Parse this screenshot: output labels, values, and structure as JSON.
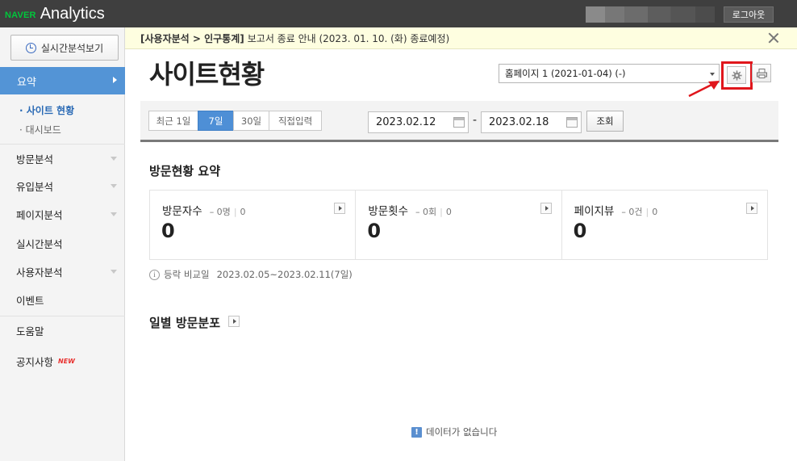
{
  "topbar": {
    "logo_brand": "NAVER",
    "logo_product": "Analytics",
    "logout_label": "로그아웃"
  },
  "sidebar": {
    "realtime_button": "실시간분석보기",
    "summary_label": "요약",
    "sub_items": [
      "· 사이트 현황",
      "· 대시보드"
    ],
    "menu": [
      "방문분석",
      "유입분석",
      "페이지분석",
      "실시간분석",
      "사용자분석",
      "이벤트",
      "도움말",
      "공지사항"
    ],
    "new_badge": "NEW"
  },
  "notice": {
    "bold": "[사용자분석 > 인구통계]",
    "text": "보고서 종료 안내 (2023. 01. 10. (화) 종료예정)"
  },
  "header": {
    "title": "사이트현황",
    "site_select": "홈페이지 1 (2021-01-04) (-)"
  },
  "filter": {
    "period_tabs": [
      "최근 1일",
      "7일",
      "30일",
      "직접입력"
    ],
    "active_tab": "7일",
    "start_date": "2023.02.12",
    "date_separator": "-",
    "end_date": "2023.02.18",
    "search_label": "조회"
  },
  "summary": {
    "title": "방문현황 요약",
    "metrics": [
      {
        "label": "방문자수",
        "delta": "– 0명",
        "prev": "0",
        "value": "0"
      },
      {
        "label": "방문횟수",
        "delta": "– 0회",
        "prev": "0",
        "value": "0"
      },
      {
        "label": "페이지뷰",
        "delta": "– 0건",
        "prev": "0",
        "value": "0"
      }
    ],
    "compare_label": "등락 비교일",
    "compare_range": "2023.02.05~2023.02.11(7일)"
  },
  "daily": {
    "title": "일별 방문분포",
    "no_data": "데이터가 없습니다"
  },
  "icons": {
    "gear": "gear-icon",
    "print": "print-icon",
    "calendar": "calendar-icon",
    "clock": "clock-icon"
  },
  "colors": {
    "accent": "#5394d6",
    "highlight": "#e0161c",
    "brand_green": "#00c73c"
  }
}
